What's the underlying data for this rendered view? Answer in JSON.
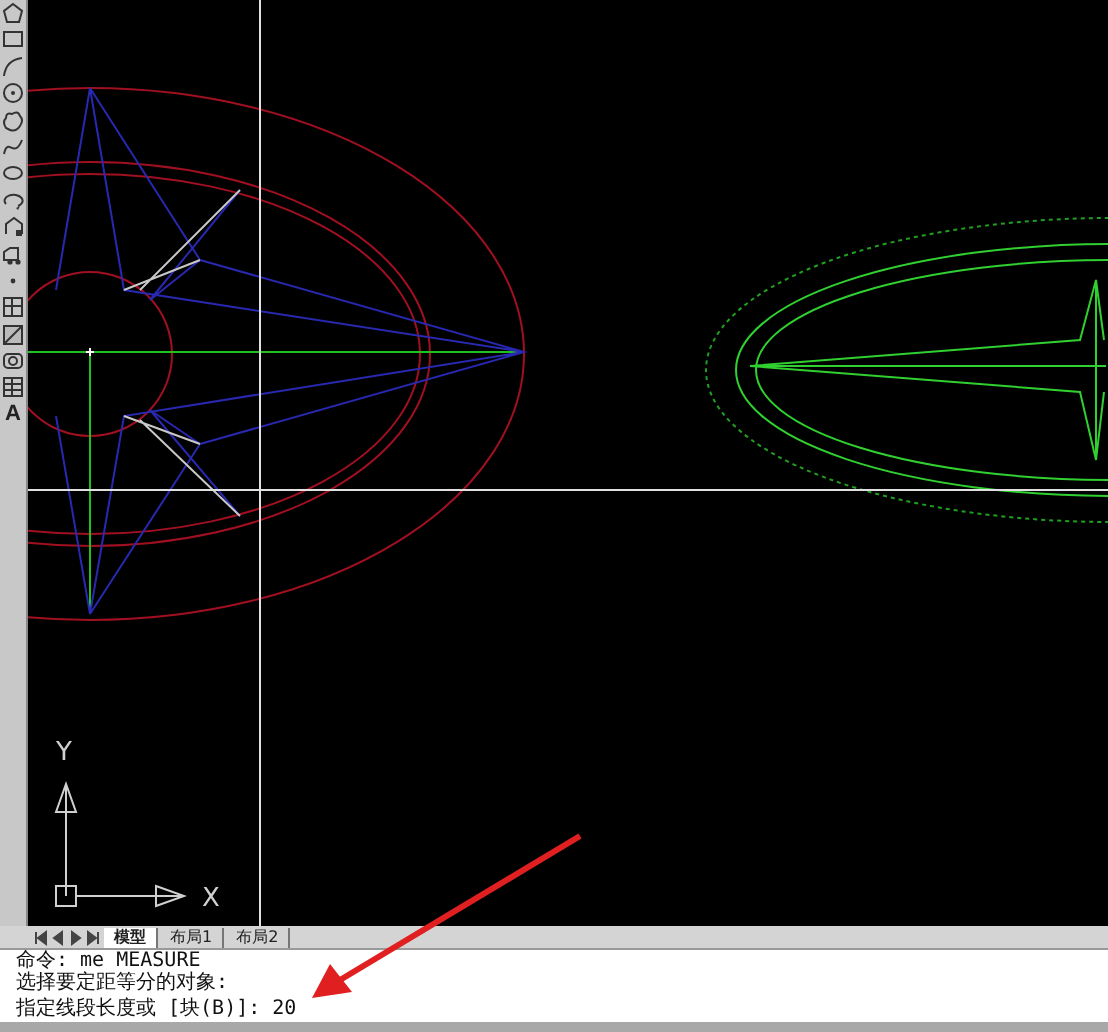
{
  "toolbar": {
    "text_tool_glyph": "A"
  },
  "canvas": {
    "ucs": {
      "x_label": "X",
      "y_label": "Y"
    }
  },
  "layout_tabs": [
    {
      "label": "模型",
      "selected": true
    },
    {
      "label": "布局1",
      "selected": false
    },
    {
      "label": "布局2",
      "selected": false
    }
  ],
  "command_line": {
    "history": [
      "命令: me MEASURE",
      "选择要定距等分的对象:"
    ],
    "prompt": "指定线段长度或 [块(B)]: 20"
  }
}
